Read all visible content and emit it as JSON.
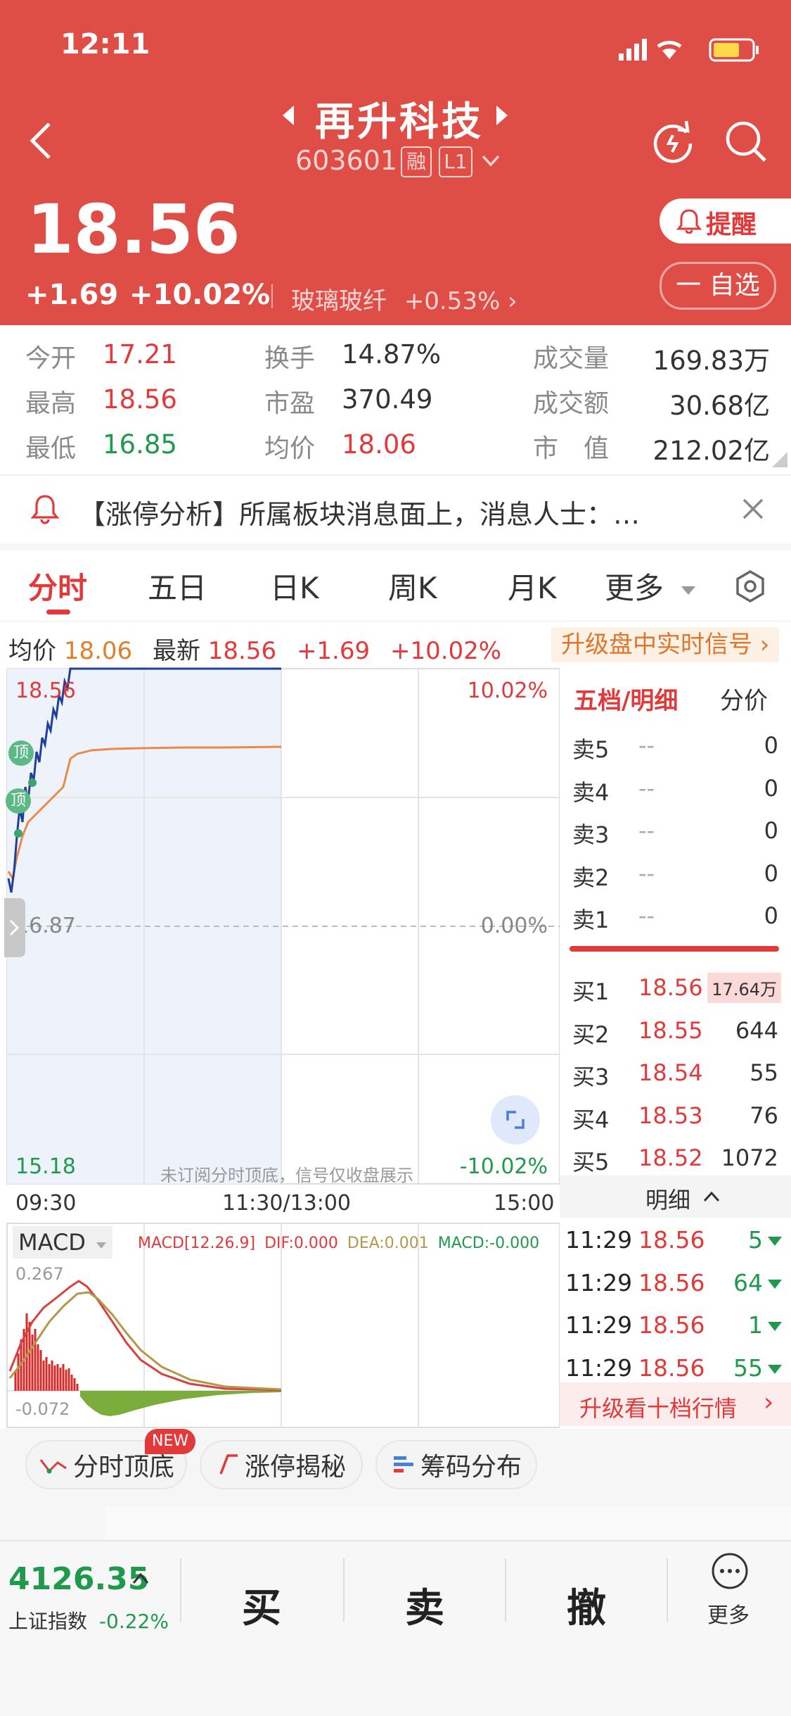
{
  "status_bar": {
    "time": "12:11"
  },
  "header": {
    "stock_name": "再升科技",
    "stock_code": "603601",
    "badge_margin": "融",
    "badge_level": "L1",
    "price": "18.56",
    "change": "+1.69",
    "change_pct": "+10.02%",
    "sector_name": "玻璃玻纤",
    "sector_change": "+0.53%",
    "remind_label": "提醒",
    "watchlist_label": "一 自选"
  },
  "stats": {
    "open_label": "今开",
    "open": "17.21",
    "high_label": "最高",
    "high": "18.56",
    "low_label": "最低",
    "low": "16.85",
    "turnover_label": "换手",
    "turnover": "14.87%",
    "pe_label": "市盈",
    "pe": "370.49",
    "avg_label": "均价",
    "avg": "18.06",
    "volume_label": "成交量",
    "volume": "169.83万",
    "amount_label": "成交额",
    "amount": "30.68亿",
    "mcap_label": "市　值",
    "mcap": "212.02亿"
  },
  "notice": {
    "text": "【涨停分析】所属板块消息面上，消息人士：…"
  },
  "tabs": {
    "t1": "分时",
    "t2": "五日",
    "t3": "日K",
    "t4": "周K",
    "t5": "月K",
    "more": "更多"
  },
  "info_row": {
    "avg_label": "均价",
    "avg": "18.06",
    "latest_label": "最新",
    "latest": "18.56",
    "change": "+1.69",
    "change_pct": "+10.02%",
    "upgrade_label": "升级盘中实时信号"
  },
  "chart": {
    "y_top": "18.56",
    "y_mid": "16.87",
    "y_bot": "15.18",
    "pct_top": "10.02%",
    "pct_mid": "0.00%",
    "pct_bot": "-10.02%",
    "signal_label": "顶",
    "watermark": "未订阅分时顶底，信号仅收盘展示",
    "x_start": "09:30",
    "x_mid": "11:30/13:00",
    "x_end": "15:00",
    "macd_selector": "MACD",
    "macd_params": "MACD[12.26.9]",
    "dif": "DIF:0.000",
    "dea": "DEA:0.001",
    "macd": "MACD:-0.000",
    "macd_top": "0.267",
    "macd_bot": "-0.072"
  },
  "order_book": {
    "title": "五档/明细",
    "split_label": "分价",
    "asks": [
      {
        "label": "卖5",
        "price": "--",
        "vol": "0"
      },
      {
        "label": "卖4",
        "price": "--",
        "vol": "0"
      },
      {
        "label": "卖3",
        "price": "--",
        "vol": "0"
      },
      {
        "label": "卖2",
        "price": "--",
        "vol": "0"
      },
      {
        "label": "卖1",
        "price": "--",
        "vol": "0"
      }
    ],
    "bids": [
      {
        "label": "买1",
        "price": "18.56",
        "vol": "17.64万"
      },
      {
        "label": "买2",
        "price": "18.55",
        "vol": "644"
      },
      {
        "label": "买3",
        "price": "18.54",
        "vol": "55"
      },
      {
        "label": "买4",
        "price": "18.53",
        "vol": "76"
      },
      {
        "label": "买5",
        "price": "18.52",
        "vol": "1072"
      }
    ],
    "detail_label": "明细",
    "ticks": [
      {
        "time": "11:29",
        "price": "18.56",
        "vol": "5"
      },
      {
        "time": "11:29",
        "price": "18.56",
        "vol": "64"
      },
      {
        "time": "11:29",
        "price": "18.56",
        "vol": "1"
      },
      {
        "time": "11:29",
        "price": "18.56",
        "vol": "55"
      }
    ],
    "upgrade_label": "升级看十档行情"
  },
  "tools": {
    "new_badge": "NEW",
    "t1": "分时顶底",
    "t2": "涨停揭秘",
    "t3": "筹码分布"
  },
  "bottom": {
    "index_value": "4126.35",
    "index_name": "上证指数",
    "index_change": "-0.22%",
    "buy": "买",
    "sell": "卖",
    "cancel": "撤",
    "more": "更多"
  },
  "colors": {
    "header_red": "#df4d47",
    "up_red": "#e2393a",
    "down_green": "#1f9a4d",
    "avg_orange": "#e07f2f"
  }
}
